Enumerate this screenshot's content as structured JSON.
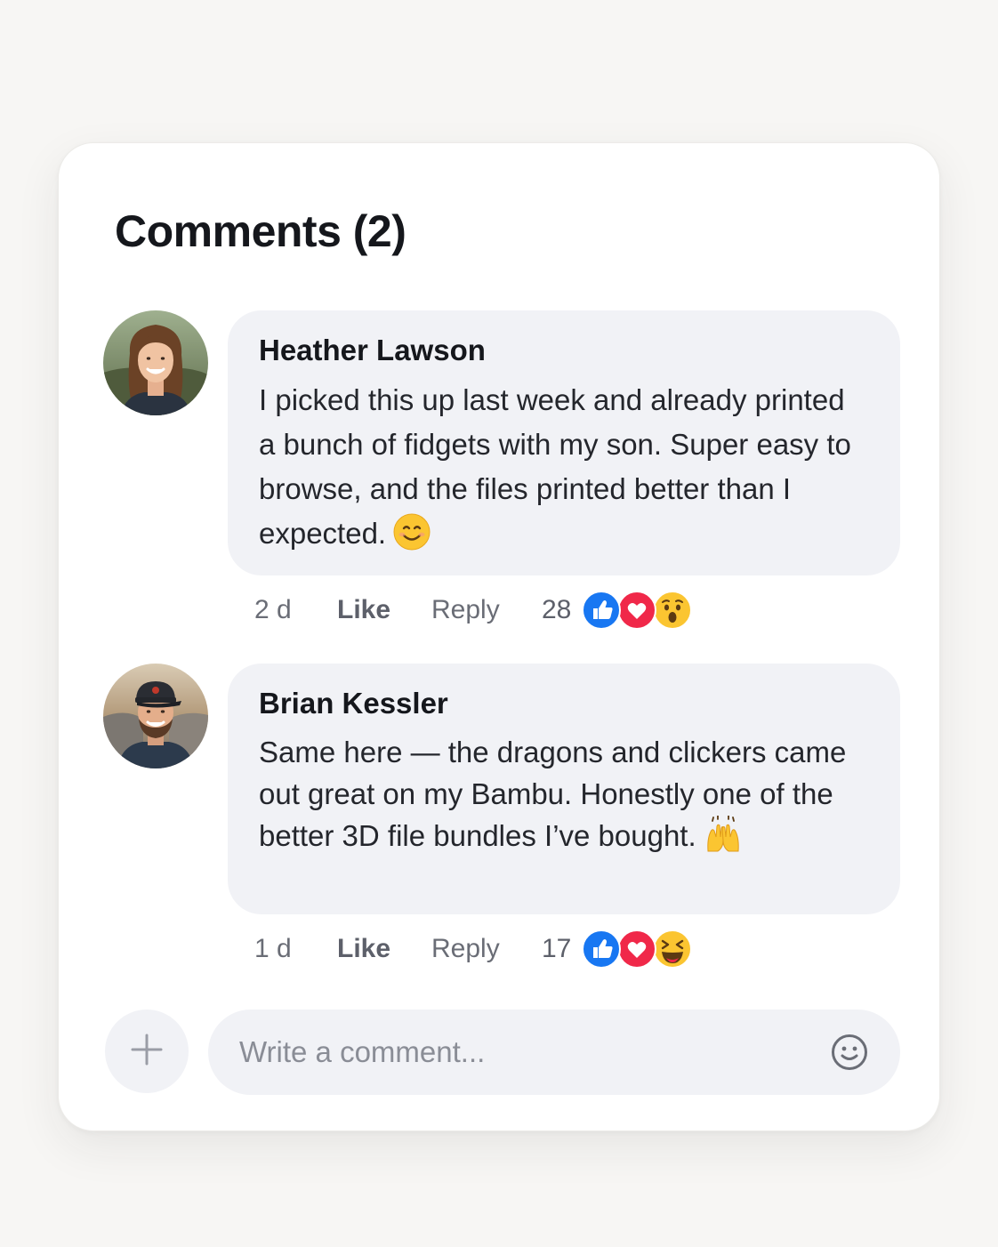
{
  "header": {
    "title": "Comments (2)"
  },
  "comments": [
    {
      "author": "Heather Lawson",
      "text": "I picked this up last week and already printed a bunch of fidgets with my son. Super easy to browse, and the files printed better than I expected.",
      "inline_emoji": "smiling-face-emoji",
      "time": "2 d",
      "like_label": "Like",
      "reply_label": "Reply",
      "reaction_count": "28",
      "reactions": [
        "like-reaction-icon",
        "love-reaction-icon",
        "wow-reaction-icon"
      ]
    },
    {
      "author": "Brian Kessler",
      "text": "Same here — the dragons and clickers came out great on my Bambu. Honestly one of the better 3D file bundles I’ve bought.",
      "inline_emoji": "raising-hands-emoji",
      "time": "1 d",
      "like_label": "Like",
      "reply_label": "Reply",
      "reaction_count": "17",
      "reactions": [
        "like-reaction-icon",
        "love-reaction-icon",
        "laugh-reaction-icon"
      ]
    }
  ],
  "composer": {
    "placeholder": "Write a comment...",
    "add_icon": "plus-icon",
    "emoji_icon": "smiley-icon"
  },
  "colors": {
    "like_blue": "#1877f2",
    "love_red": "#f02849",
    "emoji_yellow": "#fbc531",
    "bubble_bg": "#f1f2f6"
  }
}
